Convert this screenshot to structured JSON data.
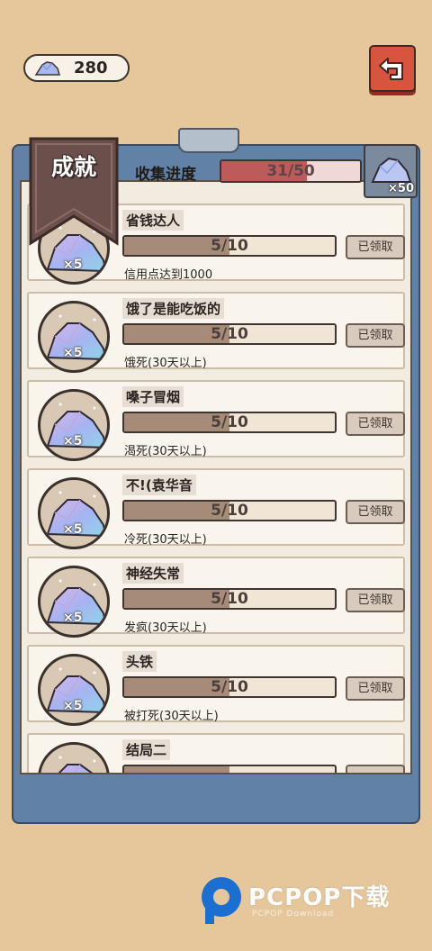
{
  "currency": {
    "amount": "280"
  },
  "header": {
    "title": "成就",
    "progress_label": "收集进度",
    "progress_text": "31/50",
    "progress_fraction": 0.62,
    "reward_multiplier": "×50"
  },
  "achievements": [
    {
      "title": "省钱达人",
      "progress": "5/10",
      "fraction": 0.5,
      "desc": "信用点达到1000",
      "claim": "已领取",
      "mult": "×5"
    },
    {
      "title": "饿了是能吃饭的",
      "progress": "5/10",
      "fraction": 0.5,
      "desc": "饿死(30天以上)",
      "claim": "已领取",
      "mult": "×5"
    },
    {
      "title": "嗓子冒烟",
      "progress": "5/10",
      "fraction": 0.5,
      "desc": "渴死(30天以上)",
      "claim": "已领取",
      "mult": "×5"
    },
    {
      "title": "不!(袁华音",
      "progress": "5/10",
      "fraction": 0.5,
      "desc": "冷死(30天以上)",
      "claim": "已领取",
      "mult": "×5"
    },
    {
      "title": "神经失常",
      "progress": "5/10",
      "fraction": 0.5,
      "desc": "发疯(30天以上)",
      "claim": "已领取",
      "mult": "×5"
    },
    {
      "title": "头铁",
      "progress": "5/10",
      "fraction": 0.5,
      "desc": "被打死(30天以上)",
      "claim": "已领取",
      "mult": "×5"
    },
    {
      "title": "结局二",
      "progress": "",
      "fraction": 0.5,
      "desc": "",
      "claim": "",
      "mult": ""
    }
  ],
  "watermark": {
    "brand": "PCPOP下载",
    "sub": "PCPOP Download"
  },
  "colors": {
    "back_button": "#d7553f",
    "board": "#6281a6",
    "progress_fill": "#bd5b5b"
  },
  "icons": {
    "currency": "crystal-gem-icon",
    "back": "return-arrow-icon",
    "achievement": "crystal-rock-icon"
  }
}
